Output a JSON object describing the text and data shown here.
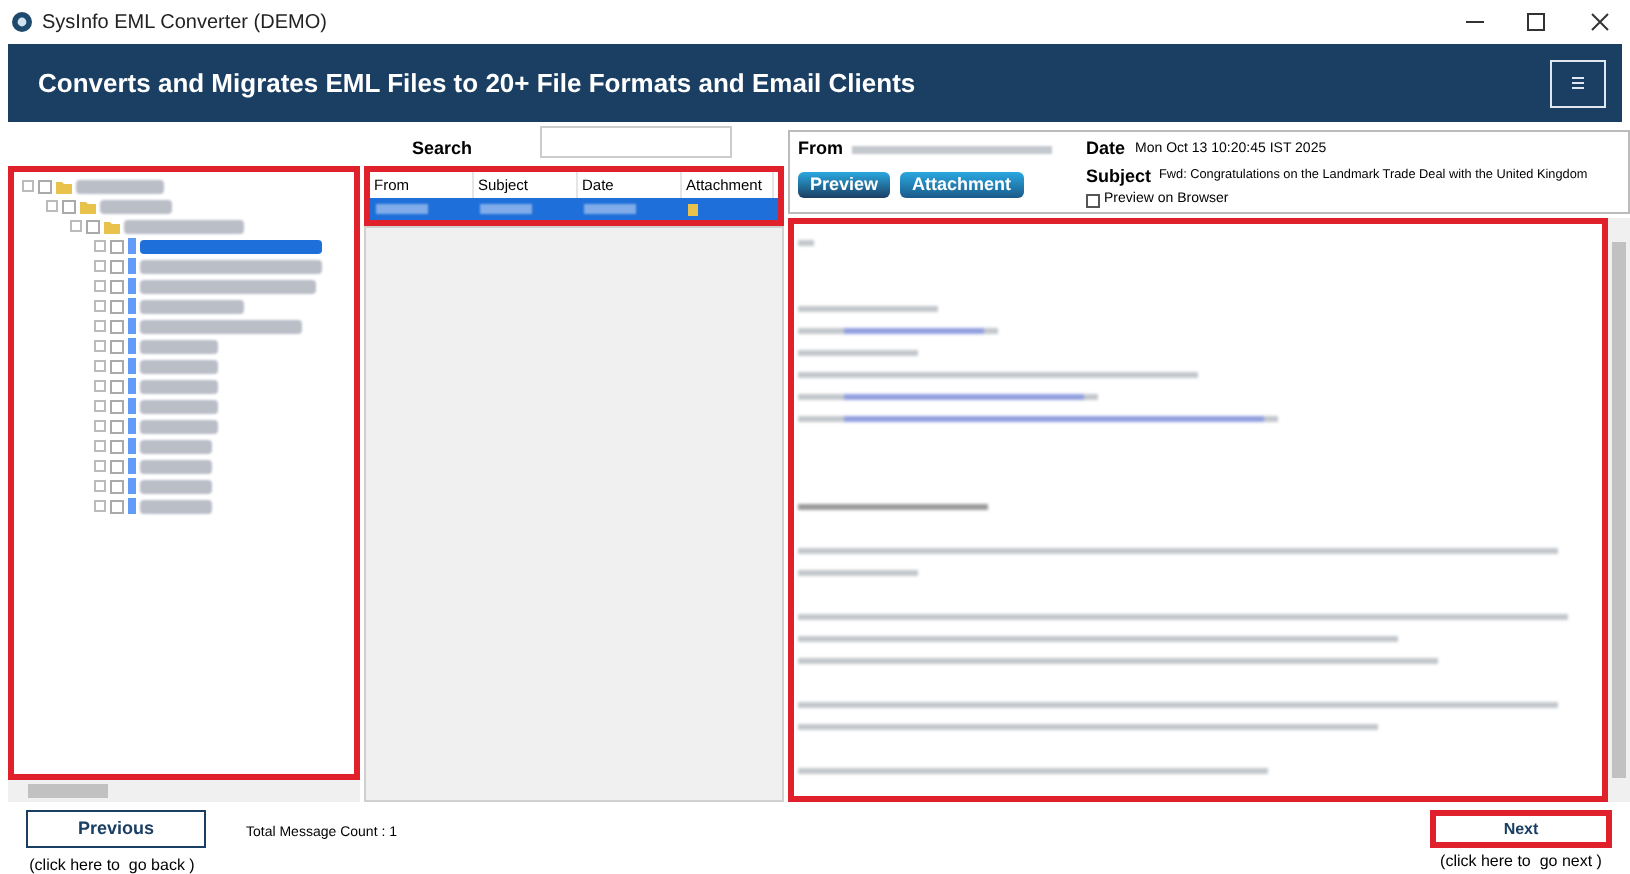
{
  "window": {
    "title": "SysInfo EML Converter (DEMO)"
  },
  "header": {
    "title": "Converts and Migrates EML Files to 20+ File Formats and Email Clients"
  },
  "search": {
    "label": "Search"
  },
  "folder_tree": [
    {
      "kind": "folder",
      "selected": false,
      "children": [
        {
          "kind": "folder",
          "selected": false,
          "children": [
            {
              "kind": "folder",
              "selected": false,
              "children": [
                {
                  "kind": "file",
                  "selected": true
                },
                {
                  "kind": "file",
                  "selected": false
                },
                {
                  "kind": "file",
                  "selected": false
                },
                {
                  "kind": "file",
                  "selected": false
                },
                {
                  "kind": "file",
                  "selected": false
                },
                {
                  "kind": "file",
                  "selected": false
                },
                {
                  "kind": "file",
                  "selected": false
                },
                {
                  "kind": "file",
                  "selected": false
                },
                {
                  "kind": "file",
                  "selected": false
                },
                {
                  "kind": "file",
                  "selected": false
                },
                {
                  "kind": "file",
                  "selected": false
                },
                {
                  "kind": "file",
                  "selected": false
                },
                {
                  "kind": "file",
                  "selected": false
                },
                {
                  "kind": "file",
                  "selected": false
                }
              ]
            }
          ]
        }
      ]
    }
  ],
  "message_table": {
    "columns": [
      "From",
      "Subject",
      "Date",
      "Attachment"
    ],
    "rows": [
      {
        "selected": true
      }
    ]
  },
  "preview": {
    "from_label": "From",
    "date_label": "Date",
    "date": "Mon Oct 13 10:20:45 IST 2025",
    "subject_label": "Subject",
    "subject": "Fwd: Congratulations on the Landmark Trade Deal with the United Kingdom",
    "buttons": [
      "Preview",
      "Attachment"
    ],
    "preview_on_browser": {
      "label": "Preview on Browser",
      "checked": false
    }
  },
  "footer": {
    "previous": "Previous",
    "previous_hint": "(click here to  go back )",
    "message_count": "Total Message Count : 1",
    "next": "Next",
    "next_hint": "(click here to  go next )"
  }
}
